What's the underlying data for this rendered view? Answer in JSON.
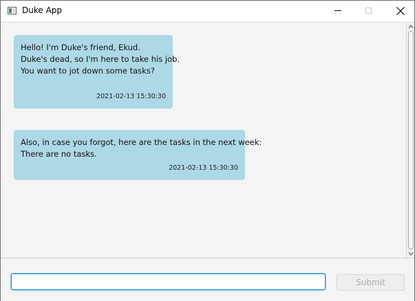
{
  "window": {
    "title": "Duke App",
    "icon": "app-window-icon",
    "controls": {
      "minimize": "minimize-icon",
      "maximize": "maximize-icon",
      "close": "close-icon"
    }
  },
  "chat": {
    "messages": [
      {
        "lines": [
          "Hello! I'm Duke's friend, Ekud.",
          "Duke's dead, so I'm here to take his job.",
          "You want to jot down some tasks?"
        ],
        "timestamp": "2021-02-13 15:30:30"
      },
      {
        "lines": [
          "Also, in case you forgot, here are the tasks in the next week:",
          "There are no tasks."
        ],
        "timestamp": "2021-02-13 15:30:30"
      }
    ]
  },
  "input": {
    "value": "",
    "placeholder": ""
  },
  "submit": {
    "label": "Submit",
    "disabled": true
  },
  "colors": {
    "bubble": "#add8e6",
    "background": "#f4f4f4",
    "focus": "#1e90d8"
  }
}
